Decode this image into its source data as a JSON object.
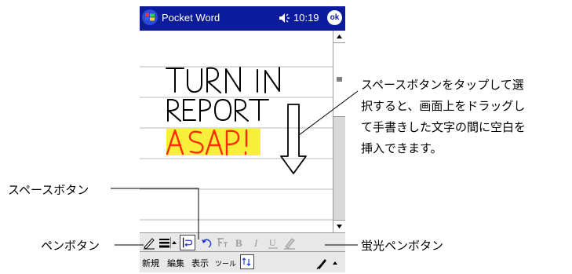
{
  "titlebar": {
    "app_title": "Pocket Word",
    "time": "10:19",
    "ok_label": "ok",
    "icons": [
      "windows-flag-icon",
      "speaker-icon"
    ]
  },
  "document": {
    "ink_lines": [
      "TURN IN",
      "REPORT",
      "ASAP!"
    ],
    "highlight_color": "#f7ef3a",
    "ink_color": "#000000",
    "highlight_ink_color": "#ff2a00"
  },
  "pen_toolbar": {
    "buttons": [
      "pen-icon",
      "line-weight-icon",
      "dropdown-arrow-icon",
      "space-icon",
      "undo-icon",
      "format-icon",
      "bold-icon",
      "italic-icon",
      "underline-icon",
      "highlight-pen-icon"
    ],
    "bold_label": "B",
    "italic_label": "I",
    "underline_label": "U"
  },
  "menubar": {
    "items": [
      "新規",
      "編集",
      "表示",
      "ツール"
    ]
  },
  "callouts": {
    "space_desc": [
      "スペースボタンをタップして選",
      "択すると、画面上をドラッグし",
      "て手書きした文字の間に空白を",
      "挿入できます。"
    ],
    "space_button": "スペースボタン",
    "pen_button": "ペンボタン",
    "highlight_pen_button": "蛍光ペンボタン"
  },
  "colors": {
    "titlebar_bg": "#0c1b9c",
    "ruled_line": "#b8b8b8"
  }
}
